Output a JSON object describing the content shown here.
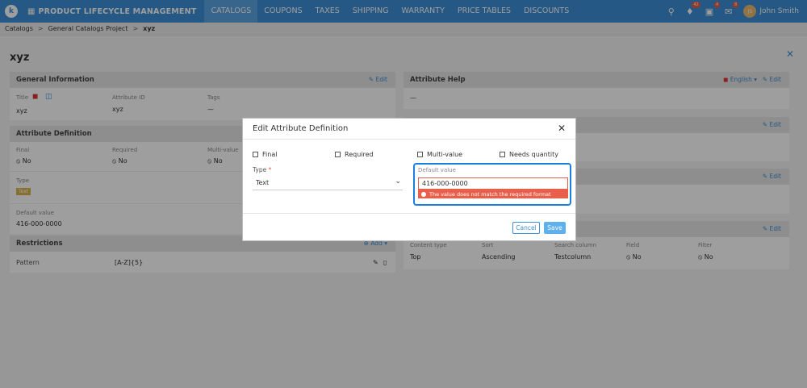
{
  "nav": {
    "app_title": "PRODUCT LIFECYCLE MANAGEMENT",
    "tabs": [
      "CATALOGS",
      "COUPONS",
      "TAXES",
      "SHIPPING",
      "WARRANTY",
      "PRICE TABLES",
      "DISCOUNTS"
    ],
    "active_tab": "CATALOGS",
    "badges": {
      "notifications": "42",
      "tasks": "4",
      "messages": "8"
    },
    "user_initials": "JS",
    "user_name": "John Smith",
    "accent_color": "#3d8fd6"
  },
  "breadcrumb": [
    "Catalogs",
    "General Catalogs Project",
    "xyz"
  ],
  "page_title": "xyz",
  "general": {
    "heading": "General Information",
    "edit": "Edit",
    "title_label": "Title",
    "title_value": "xyz",
    "attr_id_label": "Attribute ID",
    "attr_id_value": "xyz",
    "tags_label": "Tags",
    "tags_value": "—"
  },
  "attr_def": {
    "heading": "Attribute Definition",
    "final_label": "Final",
    "final_value": "No",
    "required_label": "Required",
    "required_value": "No",
    "multi_label": "Multi-value",
    "multi_value": "No",
    "type_label": "Type",
    "type_value": "Text",
    "default_label": "Default value",
    "default_value": "416-000-0000"
  },
  "restrictions": {
    "heading": "Restrictions",
    "add": "Add",
    "pattern_label": "Pattern",
    "pattern_value": "[A-Z]{5}"
  },
  "attr_help": {
    "heading": "Attribute Help",
    "language": "English",
    "edit": "Edit",
    "value": "—"
  },
  "right_panels": {
    "edit": "Edit",
    "columns": [
      "Content type",
      "Sort",
      "Search column",
      "Field",
      "Filter"
    ],
    "values": [
      "Top",
      "Ascending",
      "Testcolumn",
      "No",
      "No"
    ]
  },
  "modal": {
    "title": "Edit Attribute Definition",
    "checkboxes": [
      "Final",
      "Required",
      "Multi-value",
      "Needs quantity"
    ],
    "type_label": "Type",
    "type_value": "Text",
    "default_label": "Default value",
    "default_value": "416-000-0000",
    "error": "The value does not match the required format",
    "cancel": "Cancel",
    "save": "Save"
  }
}
